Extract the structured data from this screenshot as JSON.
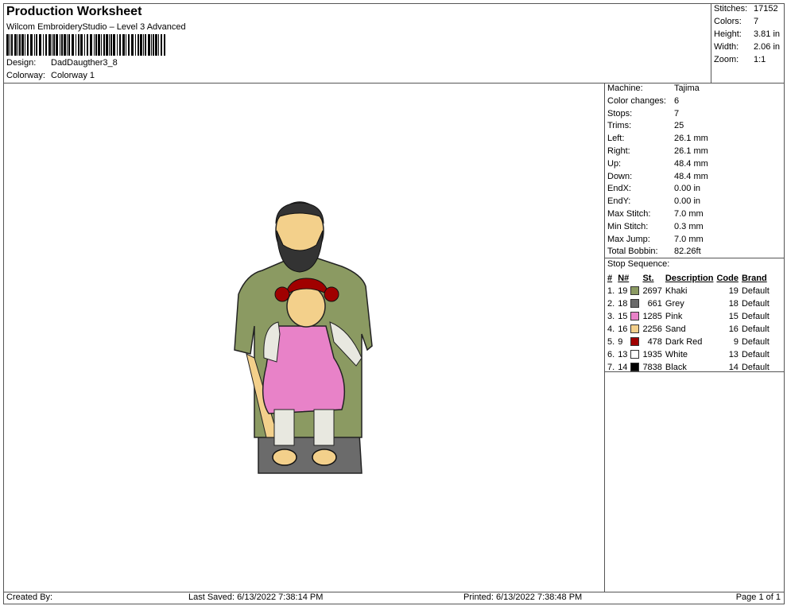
{
  "header": {
    "title": "Production Worksheet",
    "subtitle": "Wilcom EmbroideryStudio – Level 3 Advanced",
    "design_label": "Design:",
    "design_value": "DadDaugther3_8",
    "colorway_label": "Colorway:",
    "colorway_value": "Colorway 1"
  },
  "stats": [
    {
      "k": "Stitches:",
      "v": "17152"
    },
    {
      "k": "Colors:",
      "v": "7"
    },
    {
      "k": "Height:",
      "v": "3.81 in"
    },
    {
      "k": "Width:",
      "v": "2.06 in"
    },
    {
      "k": "Zoom:",
      "v": "1:1"
    }
  ],
  "info": [
    {
      "k": "Machine:",
      "v": "Tajima"
    },
    {
      "k": "Color changes:",
      "v": "6"
    },
    {
      "k": "Stops:",
      "v": "7"
    },
    {
      "k": "Trims:",
      "v": "25"
    },
    {
      "k": "Left:",
      "v": "26.1 mm"
    },
    {
      "k": "Right:",
      "v": "26.1 mm"
    },
    {
      "k": "Up:",
      "v": "48.4 mm"
    },
    {
      "k": "Down:",
      "v": "48.4 mm"
    },
    {
      "k": "EndX:",
      "v": "0.00 in"
    },
    {
      "k": "EndY:",
      "v": "0.00 in"
    },
    {
      "k": "Max Stitch:",
      "v": "7.0 mm"
    },
    {
      "k": "Min Stitch:",
      "v": "0.3 mm"
    },
    {
      "k": "Max Jump:",
      "v": "7.0 mm"
    },
    {
      "k": "Total Bobbin:",
      "v": "82.26ft"
    }
  ],
  "sequence": {
    "title": "Stop Sequence:",
    "headers": {
      "num": "#",
      "n": "N#",
      "st": "St.",
      "desc": "Description",
      "code": "Code",
      "brand": "Brand"
    },
    "rows": [
      {
        "num": "1.",
        "n": "19",
        "color": "#8b9a62",
        "st": "2697",
        "desc": "Khaki",
        "code": "19",
        "brand": "Default"
      },
      {
        "num": "2.",
        "n": "18",
        "color": "#6b6b6b",
        "st": "661",
        "desc": "Grey",
        "code": "18",
        "brand": "Default"
      },
      {
        "num": "3.",
        "n": "15",
        "color": "#e882c8",
        "st": "1285",
        "desc": "Pink",
        "code": "15",
        "brand": "Default"
      },
      {
        "num": "4.",
        "n": "16",
        "color": "#f3d08b",
        "st": "2256",
        "desc": "Sand",
        "code": "16",
        "brand": "Default"
      },
      {
        "num": "5.",
        "n": "9",
        "color": "#a00000",
        "st": "478",
        "desc": "Dark Red",
        "code": "9",
        "brand": "Default"
      },
      {
        "num": "6.",
        "n": "13",
        "color": "#ffffff",
        "st": "1935",
        "desc": "White",
        "code": "13",
        "brand": "Default"
      },
      {
        "num": "7.",
        "n": "14",
        "color": "#000000",
        "st": "7838",
        "desc": "Black",
        "code": "14",
        "brand": "Default"
      }
    ]
  },
  "footer": {
    "created": "Created By:",
    "saved": "Last Saved: 6/13/2022 7:38:14 PM",
    "printed": "Printed: 6/13/2022 7:38:48 PM",
    "page": "Page 1 of 1"
  }
}
